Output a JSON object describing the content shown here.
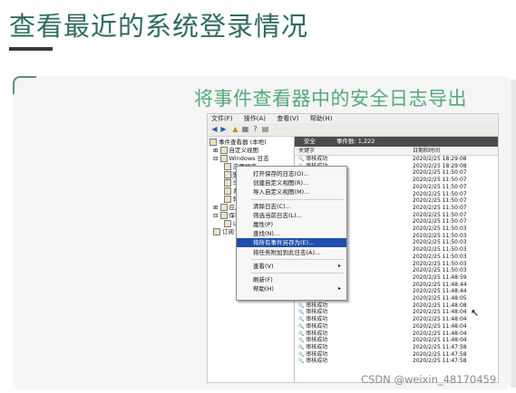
{
  "slide": {
    "title": "查看最近的系统登录情况",
    "subtitle": "将事件查看器中的安全日志导出"
  },
  "menubar": {
    "items": [
      "文件(F)",
      "操作(A)",
      "查看(V)",
      "帮助(H)"
    ]
  },
  "tree": {
    "items": [
      "事件查看器 (本地)",
      "自定义视图",
      "Windows 日志",
      "应用程序",
      "安",
      "Se",
      "系",
      "转",
      "应用和",
      "保存的",
      "L",
      "订阅"
    ]
  },
  "list_header": {
    "name": "安全",
    "count": "事件数: 1,222"
  },
  "columns": {
    "keyword": "关键字",
    "datetime": "日期和时间"
  },
  "rows": [
    {
      "keyword": "审核成功",
      "datetime": "2020/2/25 18:29:08"
    },
    {
      "keyword": "审核成功",
      "datetime": "2020/2/25 18:29:08"
    },
    {
      "keyword": "审核成功",
      "datetime": "2020/2/25 11:50:07"
    },
    {
      "keyword": "审核成功",
      "datetime": "2020/2/25 11:50:07"
    },
    {
      "keyword": "审核成功",
      "datetime": "2020/2/25 11:50:07"
    },
    {
      "keyword": "审核成功",
      "datetime": "2020/2/25 11:50:07"
    },
    {
      "keyword": "审核成功",
      "datetime": "2020/2/25 11:50:07"
    },
    {
      "keyword": "审核成功",
      "datetime": "2020/2/25 11:50:07"
    },
    {
      "keyword": "审核成功",
      "datetime": "2020/2/25 11:50:07"
    },
    {
      "keyword": "审核成功",
      "datetime": "2020/2/25 11:50:07"
    },
    {
      "keyword": "审核成功",
      "datetime": "2020/2/25 11:50:03"
    },
    {
      "keyword": "审核成功",
      "datetime": "2020/2/25 11:50:03"
    },
    {
      "keyword": "审核成功",
      "datetime": "2020/2/25 11:50:03"
    },
    {
      "keyword": "审核成功",
      "datetime": "2020/2/25 11:50:03"
    },
    {
      "keyword": "审核成功",
      "datetime": "2020/2/25 11:50:03"
    },
    {
      "keyword": "审核成功",
      "datetime": "2020/2/25 11:50:03"
    },
    {
      "keyword": "审核成功",
      "datetime": "2020/2/25 11:50:03"
    },
    {
      "keyword": "审核成功",
      "datetime": "2020/2/25 11:48:59"
    },
    {
      "keyword": "审核成功",
      "datetime": "2020/2/25 11:48:44"
    },
    {
      "keyword": "审核成功",
      "datetime": "2020/2/25 11:48:44"
    },
    {
      "keyword": "审核成功",
      "datetime": "2020/2/25 11:48:05"
    },
    {
      "keyword": "审核成功",
      "datetime": "2020/2/25 11:48:08"
    },
    {
      "keyword": "审核成功",
      "datetime": "2020/2/25 11:48:04"
    },
    {
      "keyword": "审核成功",
      "datetime": "2020/2/25 11:48:04"
    },
    {
      "keyword": "审核成功",
      "datetime": "2020/2/25 11:48:04"
    },
    {
      "keyword": "审核成功",
      "datetime": "2020/2/25 11:48:04"
    },
    {
      "keyword": "审核成功",
      "datetime": "2020/2/25 11:48:04"
    },
    {
      "keyword": "审核成功",
      "datetime": "2020/2/25 11:47:58"
    },
    {
      "keyword": "审核成功",
      "datetime": "2020/2/25 11:47:58"
    },
    {
      "keyword": "审核成功",
      "datetime": "2020/2/25 11:47:58"
    }
  ],
  "context_menu": {
    "items": [
      {
        "label": "打开保存的日志(O)..."
      },
      {
        "label": "创建自定义视图(R)..."
      },
      {
        "label": "导入自定义视图(M)..."
      },
      {
        "label": "清除日志(C)..."
      },
      {
        "label": "筛选当前日志(L)..."
      },
      {
        "label": "属性(P)"
      },
      {
        "label": "查找(N)..."
      },
      {
        "label": "将所有事件另存为(E)...",
        "highlighted": true
      },
      {
        "label": "将任务附加到此日志(A)..."
      },
      {
        "label": "查看(V)",
        "submenu": true
      },
      {
        "label": "刷新(F)"
      },
      {
        "label": "帮助(H)",
        "submenu": true
      }
    ]
  },
  "watermark": "CSDN @weixin_48170459",
  "colors": {
    "title": "#2f6b5e",
    "subtitle": "#56a87d",
    "menu_highlight": "#1f4faa",
    "list_header_bg": "#4c4c4c"
  }
}
